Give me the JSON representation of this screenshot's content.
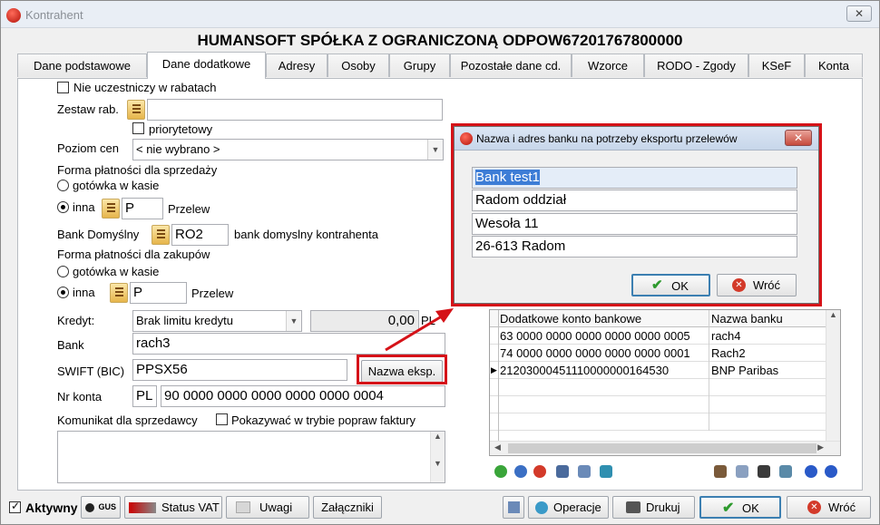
{
  "window": {
    "title": "Kontrahent",
    "close_glyph": "✕"
  },
  "heading": "HUMANSOFT SPÓŁKA Z OGRANICZONĄ ODPOW67201767800000",
  "tabs": [
    {
      "label": "Dane podstawowe"
    },
    {
      "label": "Dane dodatkowe"
    },
    {
      "label": "Adresy"
    },
    {
      "label": "Osoby"
    },
    {
      "label": "Grupy"
    },
    {
      "label": "Pozostałe dane cd."
    },
    {
      "label": "Wzorce"
    },
    {
      "label": "RODO - Zgody"
    },
    {
      "label": "KSeF"
    },
    {
      "label": "Konta"
    }
  ],
  "form": {
    "nie_uczestniczy_label": "Nie uczestniczy w rabatach",
    "zestaw_rab_label": "Zestaw rab.",
    "zestaw_rab_value": "",
    "priorytetowy_label": "priorytetowy",
    "poziom_cen_label": "Poziom cen",
    "poziom_cen_value": "< nie wybrano >",
    "forma_sprzedazy_label": "Forma płatności dla sprzedaży",
    "gotowka_label": "gotówka w kasie",
    "inna_label": "inna",
    "sprzedaz_code": "P",
    "sprzedaz_name": "Przelew",
    "bank_domyslny_label": "Bank Domyślny",
    "bank_domyslny_code": "RO2",
    "bank_domyslny_desc": "bank domyslny kontrahenta",
    "forma_zakupow_label": "Forma płatności dla zakupów",
    "zakup_gotowka_label": "gotówka w kasie",
    "zakup_inna_label": "inna",
    "zakup_code": "P",
    "zakup_name": "Przelew",
    "kredyt_label": "Kredyt:",
    "kredyt_value": "Brak limitu kredytu",
    "kredyt_amount": "0,00",
    "kredyt_currency": "PL",
    "bank_label": "Bank",
    "bank_value": "rach3",
    "swift_label": "SWIFT (BIC)",
    "swift_value": "PPSX56",
    "nazwa_eksp_button": "Nazwa eksp.",
    "nr_konta_label": "Nr konta",
    "nr_konta_prefix": "PL",
    "nr_konta_value": "90 0000 0000 0000 0000 0000 0004",
    "komunikat_label": "Komunikat dla sprzedawcy",
    "pokazywac_label": "Pokazywać w trybie popraw faktury",
    "komunikat_value": ""
  },
  "dialog": {
    "title": "Nazwa i adres banku na potrzeby eksportu przelewów",
    "close_glyph": "✕",
    "line1": "Bank test1",
    "line2": "Radom oddział",
    "line3": "Wesoła 11",
    "line4": "26-613 Radom",
    "ok_label": "OK",
    "cancel_label": "Wróć"
  },
  "accounts_grid": {
    "columns": [
      "Dodatkowe konto bankowe",
      "Nazwa banku"
    ],
    "rows": [
      {
        "account": "63 0000 0000 0000 0000 0000 0005",
        "bank": "rach4"
      },
      {
        "account": "74 0000 0000 0000 0000 0000 0001",
        "bank": "Rach2"
      },
      {
        "account": "21203000451110000000164530",
        "bank": "BNP Paribas"
      }
    ]
  },
  "bottom": {
    "aktywny_label": "Aktywny",
    "gus_label": "GUS",
    "status_vat_label": "Status VAT",
    "uwagi_label": "Uwagi",
    "zalaczniki_label": "Załączniki",
    "operacje_label": "Operacje",
    "drukuj_label": "Drukuj",
    "ok_label": "OK",
    "wroc_label": "Wróć"
  },
  "colors": {
    "highlight_red": "#d51218",
    "selection_blue": "#cfe0f7",
    "ok_green": "#2e9a2e"
  }
}
